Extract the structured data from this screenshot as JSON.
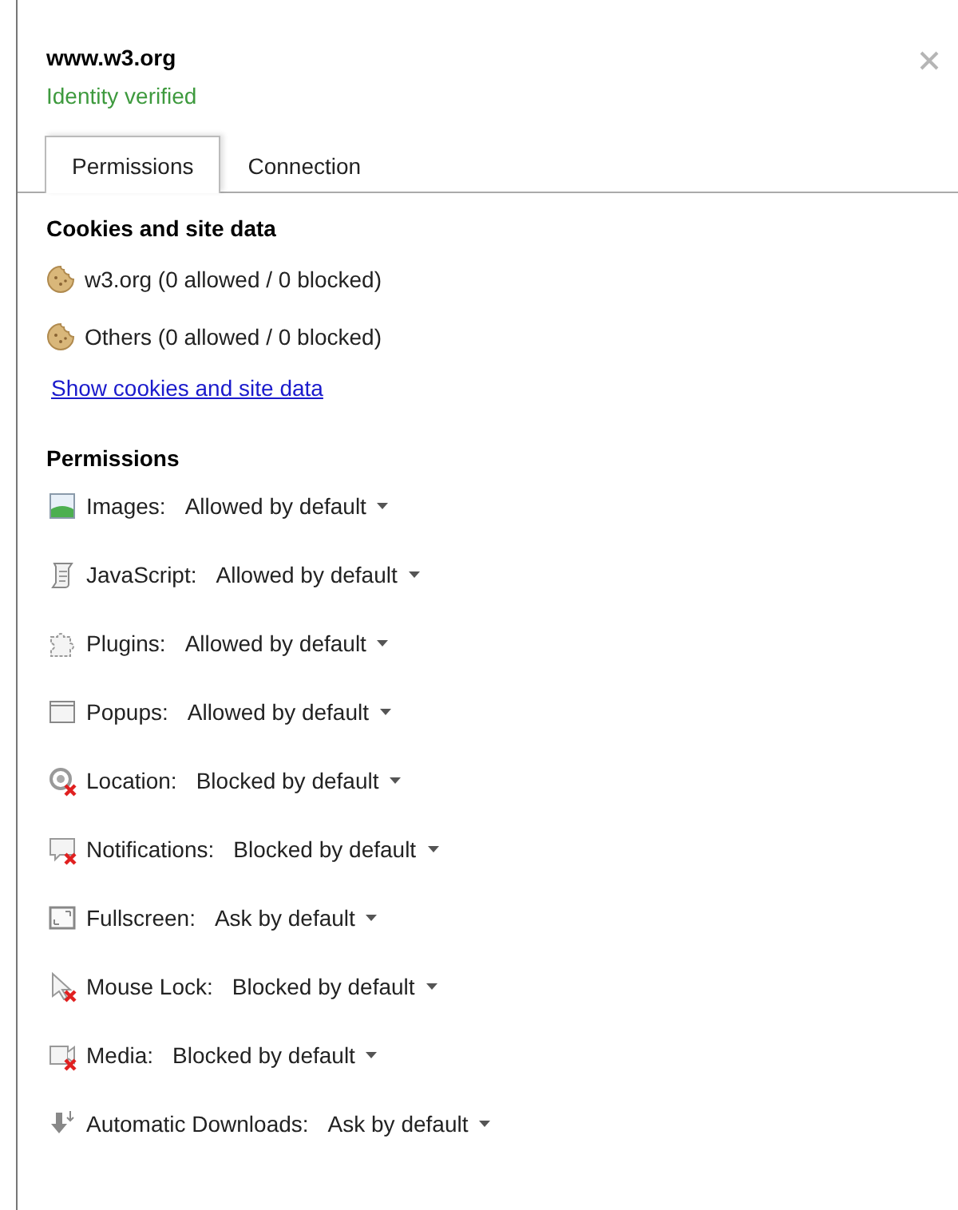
{
  "header": {
    "site": "www.w3.org",
    "identity": "Identity verified"
  },
  "tabs": [
    {
      "label": "Permissions",
      "selected": true
    },
    {
      "label": "Connection",
      "selected": false
    }
  ],
  "cookies": {
    "heading": "Cookies and site data",
    "items": [
      "w3.org (0 allowed / 0 blocked)",
      "Others (0 allowed / 0 blocked)"
    ],
    "link": "Show cookies and site data"
  },
  "permissions": {
    "heading": "Permissions",
    "items": [
      {
        "kind": "images",
        "label": "Images:",
        "setting": "Allowed by default"
      },
      {
        "kind": "javascript",
        "label": "JavaScript:",
        "setting": "Allowed by default"
      },
      {
        "kind": "plugins",
        "label": "Plugins:",
        "setting": "Allowed by default"
      },
      {
        "kind": "popups",
        "label": "Popups:",
        "setting": "Allowed by default"
      },
      {
        "kind": "location",
        "label": "Location:",
        "setting": "Blocked by default"
      },
      {
        "kind": "notifications",
        "label": "Notifications:",
        "setting": "Blocked by default"
      },
      {
        "kind": "fullscreen",
        "label": "Fullscreen:",
        "setting": "Ask by default"
      },
      {
        "kind": "mouselock",
        "label": "Mouse Lock:",
        "setting": "Blocked by default"
      },
      {
        "kind": "media",
        "label": "Media:",
        "setting": "Blocked by default"
      },
      {
        "kind": "downloads",
        "label": "Automatic Downloads:",
        "setting": "Ask by default"
      }
    ]
  }
}
